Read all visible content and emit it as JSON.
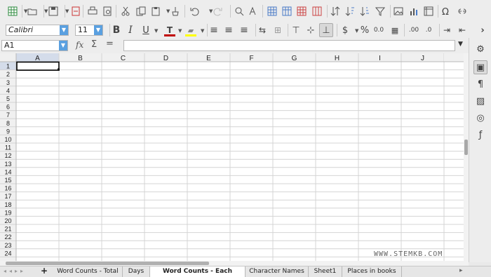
{
  "toolbar": {
    "icons": [
      "new-spreadsheet-icon",
      "open-icon",
      "save-icon",
      "export-pdf-icon",
      "print-icon",
      "print-preview-icon",
      "cut-icon",
      "copy-icon",
      "paste-icon",
      "clone-formatting-icon",
      "undo-icon",
      "redo-icon",
      "find-replace-icon",
      "spelling-icon",
      "row-icon",
      "column-icon",
      "insert-row-icon",
      "delete-row-icon",
      "sort-icon",
      "sort-ascending-icon",
      "sort-descending-icon",
      "autofilter-icon",
      "insert-image-icon",
      "insert-chart-icon",
      "pivot-table-icon",
      "special-character-icon",
      "hyperlink-icon"
    ]
  },
  "format": {
    "font_name": "Calibri",
    "font_size": "11",
    "currency_symbol": "$",
    "percent_symbol": "%",
    "decimal_label": "0.0",
    "add_decimal_label": ".00",
    "remove_decimal_label": ".0"
  },
  "formula_bar": {
    "name_box": "A1",
    "function_wizard": "fx",
    "sum_symbol": "Σ",
    "equals_symbol": "=",
    "content": ""
  },
  "grid": {
    "columns": [
      "A",
      "B",
      "C",
      "D",
      "E",
      "F",
      "G",
      "H",
      "I",
      "J"
    ],
    "rows": [
      "1",
      "2",
      "3",
      "4",
      "5",
      "6",
      "7",
      "8",
      "9",
      "10",
      "11",
      "12",
      "13",
      "14",
      "15",
      "16",
      "17",
      "18",
      "19",
      "20",
      "21",
      "22",
      "23",
      "24"
    ],
    "selected_cell": "A1"
  },
  "tabs": {
    "add_label": "+",
    "sheets": [
      "Word Counts - Total",
      "Days",
      "Word Counts - Each project",
      "Character Names",
      "Sheet1",
      "Places in books"
    ],
    "active_index": 2
  },
  "watermark": "WWW.STEMKB.COM",
  "colors": {
    "accent": "#5aa0e0",
    "font_color_bar": "#c00000",
    "highlight_bar": "#ffff00",
    "selection_header": "#d4dcea"
  }
}
